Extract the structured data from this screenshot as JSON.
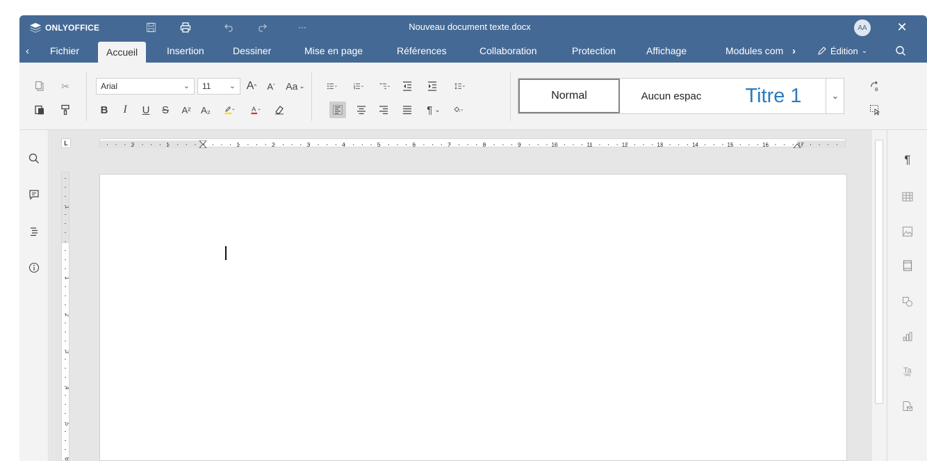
{
  "header": {
    "logo_text": "ONLYOFFICE",
    "document_title": "Nouveau document texte.docx",
    "avatar_initials": "AA",
    "more_label": "···"
  },
  "tabs": {
    "items": [
      "Fichier",
      "Accueil",
      "Insertion",
      "Dessiner",
      "Mise en page",
      "Références",
      "Collaboration",
      "Protection",
      "Affichage",
      "Modules com"
    ],
    "active": "Accueil",
    "mode_label": "Édition"
  },
  "toolbar": {
    "font_name": "Arial",
    "font_size": "11",
    "case_label": "Aa",
    "bold_label": "B",
    "italic_label": "I",
    "underline_label": "U",
    "strike_label": "S",
    "superscript_label": "A²",
    "subscript_label": "A₂",
    "grow_label": "A",
    "shrink_label": "A",
    "paragraph_mark": "¶"
  },
  "styles": {
    "items": [
      "Normal",
      "Aucun espac",
      "Titre 1"
    ],
    "selected": "Normal"
  },
  "colors": {
    "header_bg": "#446995",
    "accent": "#2b7bbd",
    "highlight": "#ffe000",
    "font_color": "#d32f2f"
  },
  "ruler": {
    "corner_label": "L",
    "h_numbers": [
      "2",
      "1",
      "1",
      "2",
      "3",
      "4",
      "5",
      "6",
      "7",
      "8",
      "9",
      "10",
      "11",
      "12",
      "13",
      "14",
      "15",
      "16",
      "17"
    ],
    "v_numbers": [
      "1",
      "1",
      "2",
      "3",
      "4",
      "5",
      "6"
    ]
  },
  "left_panel": {
    "icons": [
      "search-icon",
      "comments-icon",
      "navigation-icon",
      "about-icon"
    ]
  },
  "right_panel": {
    "icons": [
      "paragraph-settings-icon",
      "table-settings-icon",
      "image-settings-icon",
      "header-footer-icon",
      "shape-settings-icon",
      "chart-settings-icon",
      "text-art-icon",
      "mail-merge-icon"
    ]
  }
}
